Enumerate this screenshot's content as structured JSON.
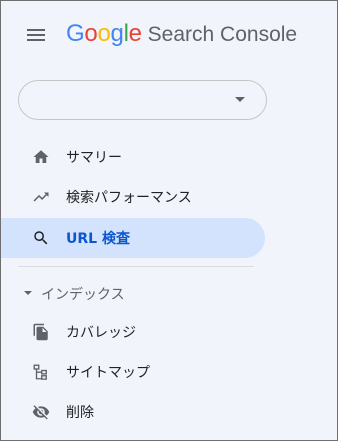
{
  "header": {
    "logo": {
      "letters": [
        {
          "ch": "G",
          "color": "#4285F4"
        },
        {
          "ch": "o",
          "color": "#EA4335"
        },
        {
          "ch": "o",
          "color": "#FBBC05"
        },
        {
          "ch": "g",
          "color": "#4285F4"
        },
        {
          "ch": "l",
          "color": "#34A853"
        },
        {
          "ch": "e",
          "color": "#EA4335"
        }
      ]
    },
    "product": "Search Console",
    "menu_icon": "hamburger-menu-icon"
  },
  "property_selector": {
    "value": "",
    "icon": "dropdown-arrow-icon"
  },
  "nav": {
    "summary": {
      "label": "サマリー",
      "icon": "home-icon"
    },
    "performance": {
      "label": "検索パフォーマンス",
      "icon": "trending-up-icon"
    },
    "url_inspection": {
      "label": "URL 検査",
      "icon": "search-icon",
      "active": true
    }
  },
  "index_section": {
    "title": "インデックス",
    "expanded": true,
    "items": [
      {
        "label": "カバレッジ",
        "icon": "coverage-icon"
      },
      {
        "label": "サイトマップ",
        "icon": "sitemap-icon"
      },
      {
        "label": "削除",
        "icon": "visibility-off-icon"
      }
    ]
  },
  "colors": {
    "background": "#f1f5fb",
    "active_bg": "#d3e3fd",
    "active_text": "#0b57d0",
    "icon": "#5f6368",
    "text": "#202124"
  }
}
